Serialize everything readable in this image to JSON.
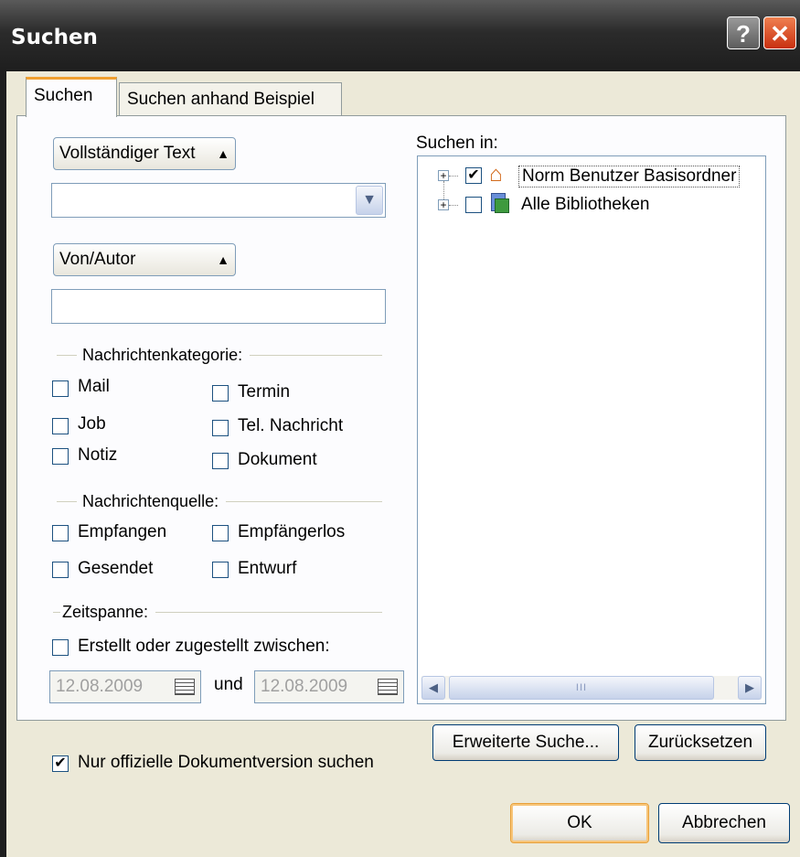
{
  "window": {
    "title": "Suchen",
    "help_glyph": "?",
    "close_glyph": "✕"
  },
  "tabs": [
    {
      "label": "Suchen"
    },
    {
      "label": "Suchen anhand Beispiel"
    }
  ],
  "fields": {
    "text_field_type": "Vollständiger Text",
    "search_text_value": "",
    "author_field_type": "Von/Autor",
    "author_value": ""
  },
  "categories": {
    "title": "Nachrichtenkategorie:",
    "items": [
      {
        "label": "Mail",
        "checked": false
      },
      {
        "label": "Termin",
        "checked": false
      },
      {
        "label": "Job",
        "checked": false
      },
      {
        "label": "Tel. Nachricht",
        "checked": false
      },
      {
        "label": "Notiz",
        "checked": false
      },
      {
        "label": "Dokument",
        "checked": false
      }
    ]
  },
  "sources": {
    "title": "Nachrichtenquelle:",
    "items": [
      {
        "label": "Empfangen",
        "checked": false
      },
      {
        "label": "Empfängerlos",
        "checked": false
      },
      {
        "label": "Gesendet",
        "checked": false
      },
      {
        "label": "Entwurf",
        "checked": false
      }
    ]
  },
  "timespan": {
    "title": "Zeitspanne:",
    "range_label": "Erstellt oder zugestellt zwischen:",
    "range_checked": false,
    "from_date": "12.08.2009",
    "and_label": "und",
    "to_date": "12.08.2009"
  },
  "search_in": {
    "label": "Suchen in:",
    "tree": [
      {
        "label": "Norm Benutzer Basisordner",
        "checked": true,
        "icon": "home-icon"
      },
      {
        "label": "Alle Bibliotheken",
        "checked": false,
        "icon": "books-icon"
      }
    ],
    "scroll_grip": "III"
  },
  "official_version": {
    "label": "Nur offizielle Dokumentversion suchen",
    "checked": true
  },
  "buttons": {
    "advanced": "Erweiterte Suche...",
    "reset": "Zurücksetzen",
    "ok": "OK",
    "cancel": "Abbrechen"
  },
  "colors": {
    "tab_accent": "#f0a030",
    "close_button": "#d9441c",
    "titlebar": "#2b2b2b"
  }
}
